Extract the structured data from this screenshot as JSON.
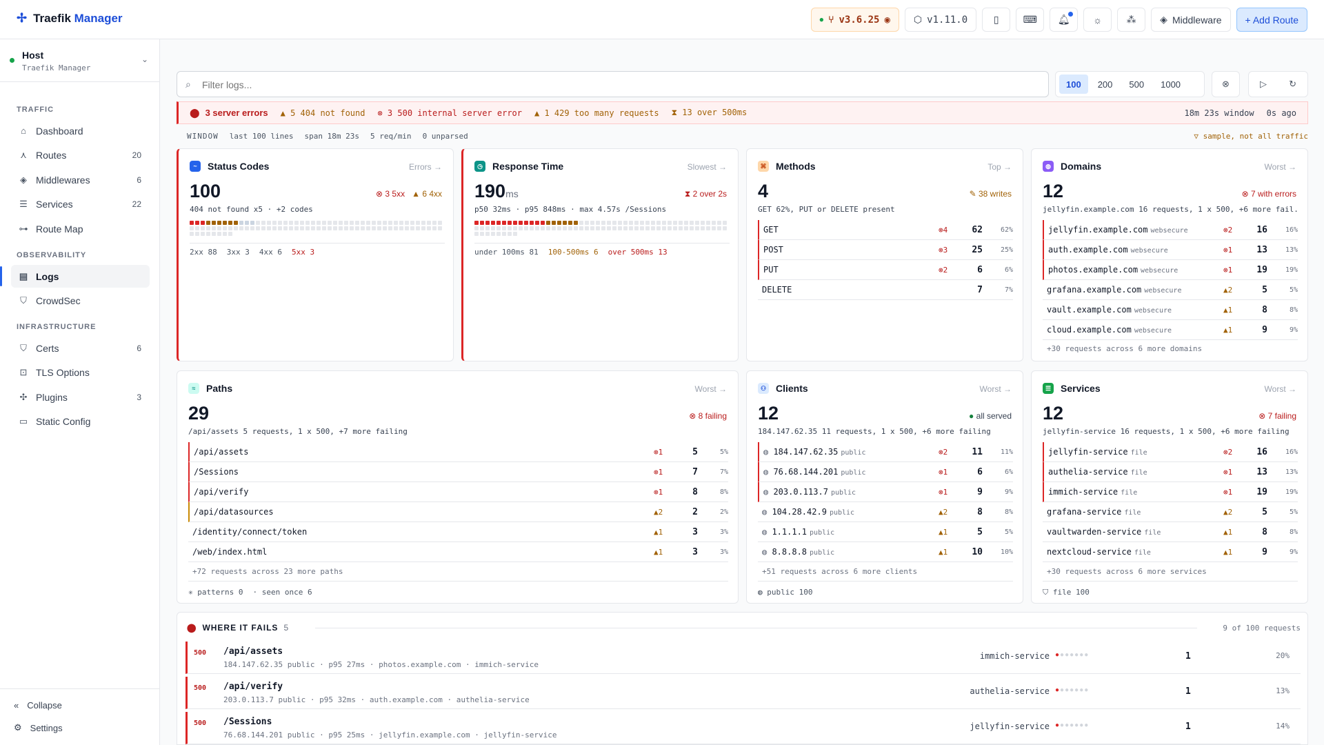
{
  "header": {
    "logo_a": "Traefik",
    "logo_b": " Manager",
    "version": "v3.6.25",
    "app_version": "v1.11.0",
    "middleware_label": "Middleware",
    "add_route_label": "+ Add Route"
  },
  "sidebar": {
    "host_title": "Host",
    "host_sub": "Traefik Manager",
    "sections": [
      "TRAFFIC",
      "OBSERVABILITY",
      "INFRASTRUCTURE"
    ],
    "items": [
      {
        "label": "Dashboard",
        "count": ""
      },
      {
        "label": "Routes",
        "count": "20"
      },
      {
        "label": "Middlewares",
        "count": "6"
      },
      {
        "label": "Services",
        "count": "22"
      },
      {
        "label": "Route Map",
        "count": ""
      },
      {
        "label": "Logs",
        "count": ""
      },
      {
        "label": "CrowdSec",
        "count": ""
      },
      {
        "label": "Certs",
        "count": "6"
      },
      {
        "label": "TLS Options",
        "count": ""
      },
      {
        "label": "Plugins",
        "count": "3"
      },
      {
        "label": "Static Config",
        "count": ""
      }
    ],
    "collapse": "Collapse",
    "settings": "Settings"
  },
  "filter": {
    "placeholder": "Filter logs...",
    "limits": [
      "100",
      "200",
      "500",
      "1000"
    ]
  },
  "error_bar": {
    "title": "3 server errors",
    "e404": "5 404 not found",
    "e500": "3 500 internal server error",
    "e429": "1 429 too many requests",
    "slow": "13 over 500ms",
    "window": "18m 23s window",
    "ago": "0s ago"
  },
  "window_bar": {
    "label": "WINDOW",
    "lines": "last 100 lines",
    "span": "span 18m 23s",
    "rate": "5 req/min",
    "unparsed": "0 unparsed",
    "sample": "sample, not all traffic"
  },
  "status": {
    "title": "Status Codes",
    "link": "Errors →",
    "big": "100",
    "b5": "3 5xx",
    "b4": "6 4xx",
    "sub": "404 not found x5 · +2 codes",
    "f2": "2xx 88",
    "f3": "3xx 3",
    "f4": "4xx 6",
    "f5": "5xx 3"
  },
  "response": {
    "title": "Response Time",
    "link": "Slowest →",
    "big": "190",
    "unit": "ms",
    "badge": "2 over 2s",
    "sub": "p50 32ms · p95 848ms · max 4.57s /Sessions",
    "f1": "under 100ms 81",
    "f2": "100-500ms 6",
    "f3": "over 500ms 13"
  },
  "methods": {
    "title": "Methods",
    "link": "Top →",
    "big": "4",
    "badge": "38 writes",
    "sub": "GET 62%, PUT or DELETE present",
    "rows": [
      {
        "n": "GET",
        "e": "4",
        "v": "62",
        "p": "62%"
      },
      {
        "n": "POST",
        "e": "3",
        "v": "25",
        "p": "25%"
      },
      {
        "n": "PUT",
        "e": "2",
        "v": "6",
        "p": "6%"
      },
      {
        "n": "DELETE",
        "e": "",
        "v": "7",
        "p": "7%"
      }
    ]
  },
  "domains": {
    "title": "Domains",
    "link": "Worst →",
    "big": "12",
    "badge": "7 with errors",
    "sub": "jellyfin.example.com 16 requests, 1 x 500, +6 more fail...",
    "rows": [
      {
        "n": "jellyfin.example.com",
        "t": "websecure",
        "e": "2",
        "v": "16",
        "p": "16%"
      },
      {
        "n": "auth.example.com",
        "t": "websecure",
        "e": "1",
        "v": "13",
        "p": "13%"
      },
      {
        "n": "photos.example.com",
        "t": "websecure",
        "e": "1",
        "v": "19",
        "p": "19%"
      },
      {
        "n": "grafana.example.com",
        "t": "websecure",
        "w": "2",
        "v": "5",
        "p": "5%"
      },
      {
        "n": "vault.example.com",
        "t": "websecure",
        "w": "1",
        "v": "8",
        "p": "8%"
      },
      {
        "n": "cloud.example.com",
        "t": "websecure",
        "w": "1",
        "v": "9",
        "p": "9%"
      }
    ],
    "more": "+30 requests across 6 more domains"
  },
  "paths": {
    "title": "Paths",
    "link": "Worst →",
    "big": "29",
    "badge": "8 failing",
    "sub": "/api/assets 5 requests, 1 x 500, +7 more failing",
    "rows": [
      {
        "n": "/api/assets",
        "e": "1",
        "v": "5",
        "p": "5%"
      },
      {
        "n": "/Sessions",
        "e": "1",
        "v": "7",
        "p": "7%"
      },
      {
        "n": "/api/verify",
        "e": "1",
        "v": "8",
        "p": "8%"
      },
      {
        "n": "/api/datasources",
        "w": "2",
        "v": "2",
        "p": "2%"
      },
      {
        "n": "/identity/connect/token",
        "w": "1",
        "v": "3",
        "p": "3%"
      },
      {
        "n": "/web/index.html",
        "w": "1",
        "v": "3",
        "p": "3%"
      }
    ],
    "more": "+72 requests across 23 more paths",
    "foot1": "patterns 0",
    "foot2": "· seen once 6"
  },
  "clients": {
    "title": "Clients",
    "link": "Worst →",
    "big": "12",
    "badge": "all served",
    "sub": "184.147.62.35 11 requests, 1 x 500, +6 more failing",
    "rows": [
      {
        "n": "184.147.62.35",
        "t": "public",
        "e": "2",
        "v": "11",
        "p": "11%"
      },
      {
        "n": "76.68.144.201",
        "t": "public",
        "e": "1",
        "v": "6",
        "p": "6%"
      },
      {
        "n": "203.0.113.7",
        "t": "public",
        "e": "1",
        "v": "9",
        "p": "9%"
      },
      {
        "n": "104.28.42.9",
        "t": "public",
        "w": "2",
        "v": "8",
        "p": "8%"
      },
      {
        "n": "1.1.1.1",
        "t": "public",
        "w": "1",
        "v": "5",
        "p": "5%"
      },
      {
        "n": "8.8.8.8",
        "t": "public",
        "w": "1",
        "v": "10",
        "p": "10%"
      }
    ],
    "more": "+51 requests across 6 more clients",
    "foot": "public 100"
  },
  "services": {
    "title": "Services",
    "link": "Worst →",
    "big": "12",
    "badge": "7 failing",
    "sub": "jellyfin-service 16 requests, 1 x 500, +6 more failing",
    "rows": [
      {
        "n": "jellyfin-service",
        "t": "file",
        "e": "2",
        "v": "16",
        "p": "16%"
      },
      {
        "n": "authelia-service",
        "t": "file",
        "e": "1",
        "v": "13",
        "p": "13%"
      },
      {
        "n": "immich-service",
        "t": "file",
        "e": "1",
        "v": "19",
        "p": "19%"
      },
      {
        "n": "grafana-service",
        "t": "file",
        "w": "2",
        "v": "5",
        "p": "5%"
      },
      {
        "n": "vaultwarden-service",
        "t": "file",
        "w": "1",
        "v": "8",
        "p": "8%"
      },
      {
        "n": "nextcloud-service",
        "t": "file",
        "w": "1",
        "v": "9",
        "p": "9%"
      }
    ],
    "more": "+30 requests across 6 more services",
    "foot": "file 100"
  },
  "fails": {
    "title": "WHERE IT FAILS",
    "count": "5",
    "right": "9 of 100 requests",
    "rows": [
      {
        "code": "500",
        "path": "/api/assets",
        "meta": "184.147.62.35 public · p95 27ms · photos.example.com · immich-service",
        "svc": "immich-service",
        "cnt": "1",
        "pc": "20%"
      },
      {
        "code": "500",
        "path": "/api/verify",
        "meta": "203.0.113.7 public · p95 32ms · auth.example.com · authelia-service",
        "svc": "authelia-service",
        "cnt": "1",
        "pc": "13%"
      },
      {
        "code": "500",
        "path": "/Sessions",
        "meta": "76.68.144.201 public · p95 25ms · jellyfin.example.com · jellyfin-service",
        "svc": "jellyfin-service",
        "cnt": "1",
        "pc": "14%"
      }
    ]
  }
}
